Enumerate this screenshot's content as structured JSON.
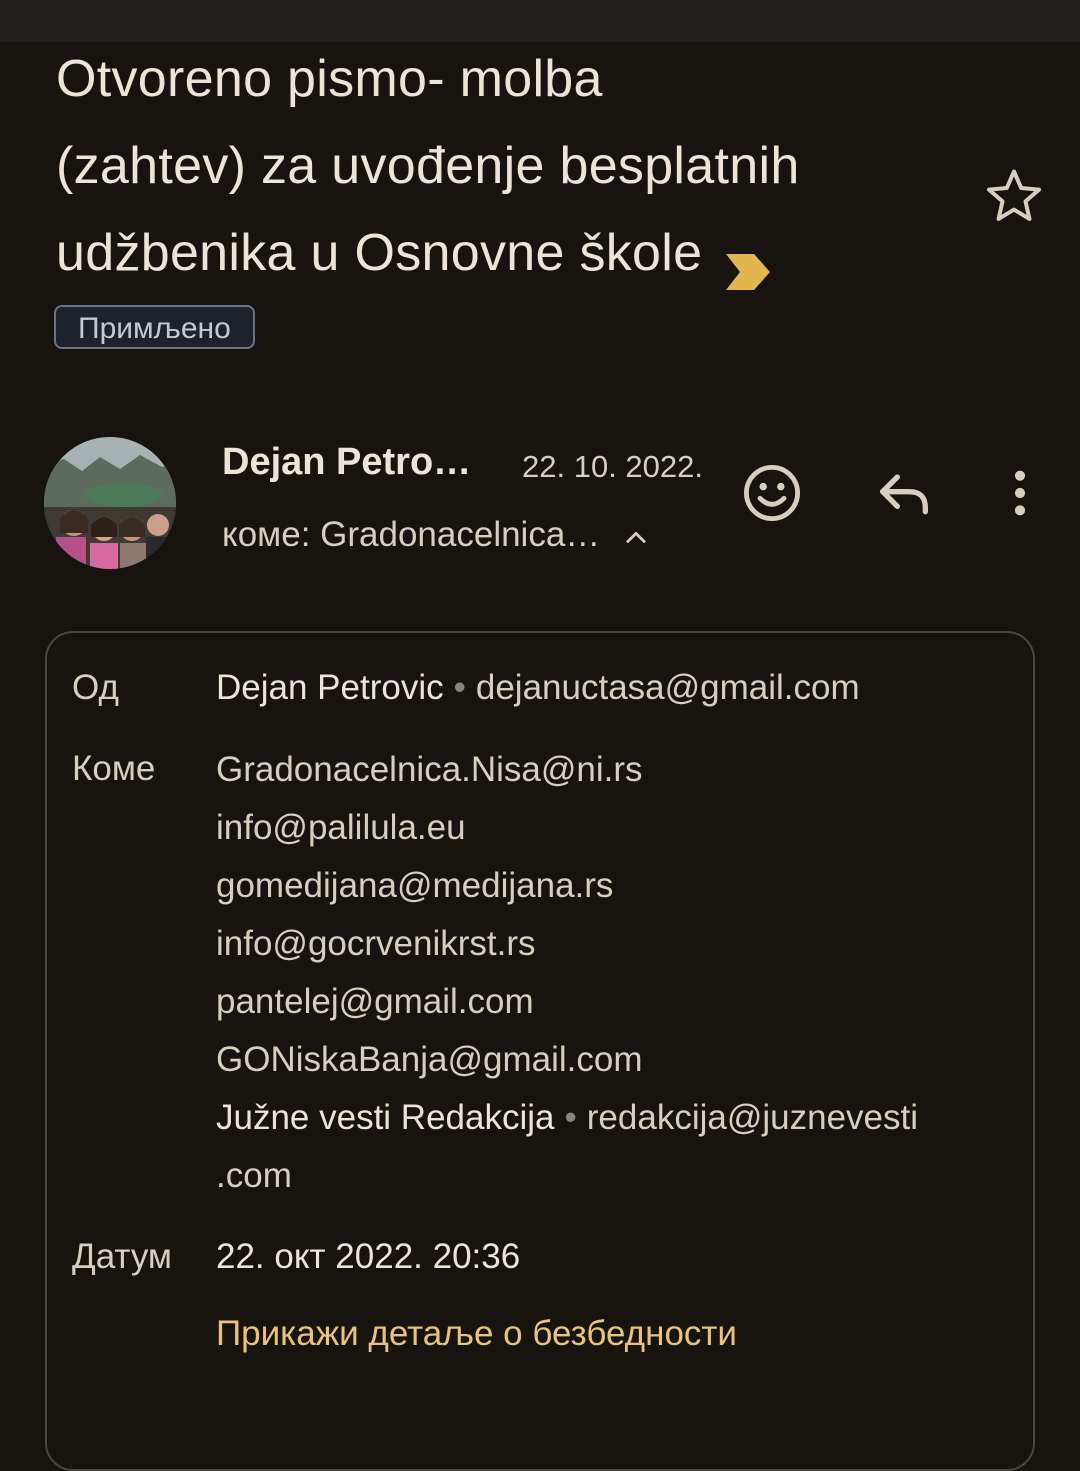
{
  "subject": {
    "line1": "Otvoreno pismo- molba",
    "line2": "(zahtev) za uvođenje besplatnih",
    "line3": "udžbenika u Osnovne škole"
  },
  "label": "Примљено",
  "sender": {
    "name": "Dejan Petro…",
    "date": "22. 10. 2022.",
    "to_summary": "коме: Gradonacelnica…"
  },
  "details": {
    "from_label": "Од",
    "from_name": "Dejan Petrovic",
    "from_email": "dejanuctasa@gmail.com",
    "to_label": "Коме",
    "recipients": [
      "Gradonacelnica.Nisa@ni.rs",
      "info@palilula.eu",
      "gomedijana@medijana.rs",
      "info@gocrvenikrst.rs",
      "pantelej@gmail.com",
      "GONiskaBanja@gmail.com"
    ],
    "last_recipient_name": "Južne vesti Redakcija",
    "last_recipient_email_part1": "redakcija@juznevesti",
    "last_recipient_email_part2": ".com",
    "date_label": "Датум",
    "date_value": "22. окт 2022. 20:36",
    "security_link": "Прикажи детаље о безбедности"
  },
  "colors": {
    "background": "#17140f",
    "importance_marker": "#e2b84e",
    "link": "#e8c474"
  },
  "icons": [
    "star-icon",
    "importance-marker-icon",
    "emoji-icon",
    "reply-icon",
    "more-vert-icon",
    "chevron-up-icon"
  ]
}
